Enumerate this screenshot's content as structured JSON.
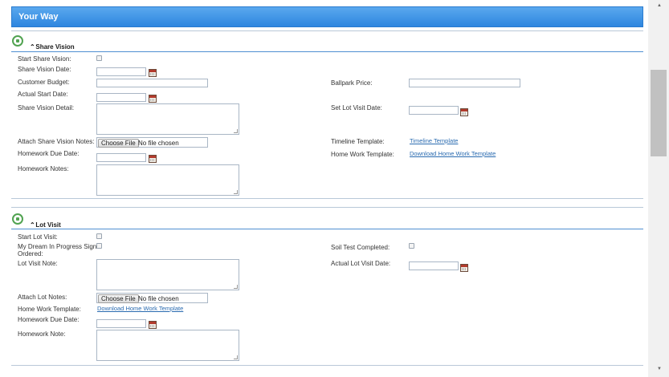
{
  "banner": {
    "title": "Your Way"
  },
  "share_vision": {
    "title": "Share Vision",
    "start_label": "Start Share Vision:",
    "date_label": "Share Vision Date:",
    "customer_budget_label": "Customer Budget:",
    "ballpark_price_label": "Ballpark Price:",
    "actual_start_label": "Actual Start Date:",
    "detail_label": "Share Vision Detail:",
    "set_lot_visit_label": "Set Lot Visit Date:",
    "attach_notes_label": "Attach Share Vision Notes:",
    "choose_file": "Choose File",
    "no_file": "No file chosen",
    "timeline_template_label": "Timeline Template:",
    "timeline_template_link": "Timeline Template",
    "homework_due_label": "Homework Due Date:",
    "homework_template_label": "Home Work Template:",
    "homework_template_link": "Download Home Work Template",
    "homework_notes_label": "Homework Notes:"
  },
  "lot_visit": {
    "title": "Lot Visit",
    "start_label": "Start Lot Visit:",
    "dream_sign_label_1": "My Dream In Progress Sign",
    "dream_sign_label_2": "Ordered:",
    "soil_test_label": "Soil Test Completed:",
    "note_label": "Lot Visit Note:",
    "actual_date_label": "Actual Lot Visit Date:",
    "attach_notes_label": "Attach Lot Notes:",
    "choose_file": "Choose File",
    "no_file": "No file chosen",
    "homework_template_label": "Home Work Template:",
    "homework_template_link": "Download Home Work Template",
    "homework_due_label": "Homework Due Date:",
    "homework_note_label": "Homework Note:"
  },
  "scrollbar": {
    "up_icon": "▲",
    "down_icon": "▼"
  },
  "colors": {
    "banner": "#3b8fe2",
    "section_icon": "#51a351",
    "link": "#2a6bb0"
  },
  "icons": {
    "section_toggle": "double-chevron-up-icon",
    "calendar": "calendar-icon",
    "section": "circle-icon"
  }
}
